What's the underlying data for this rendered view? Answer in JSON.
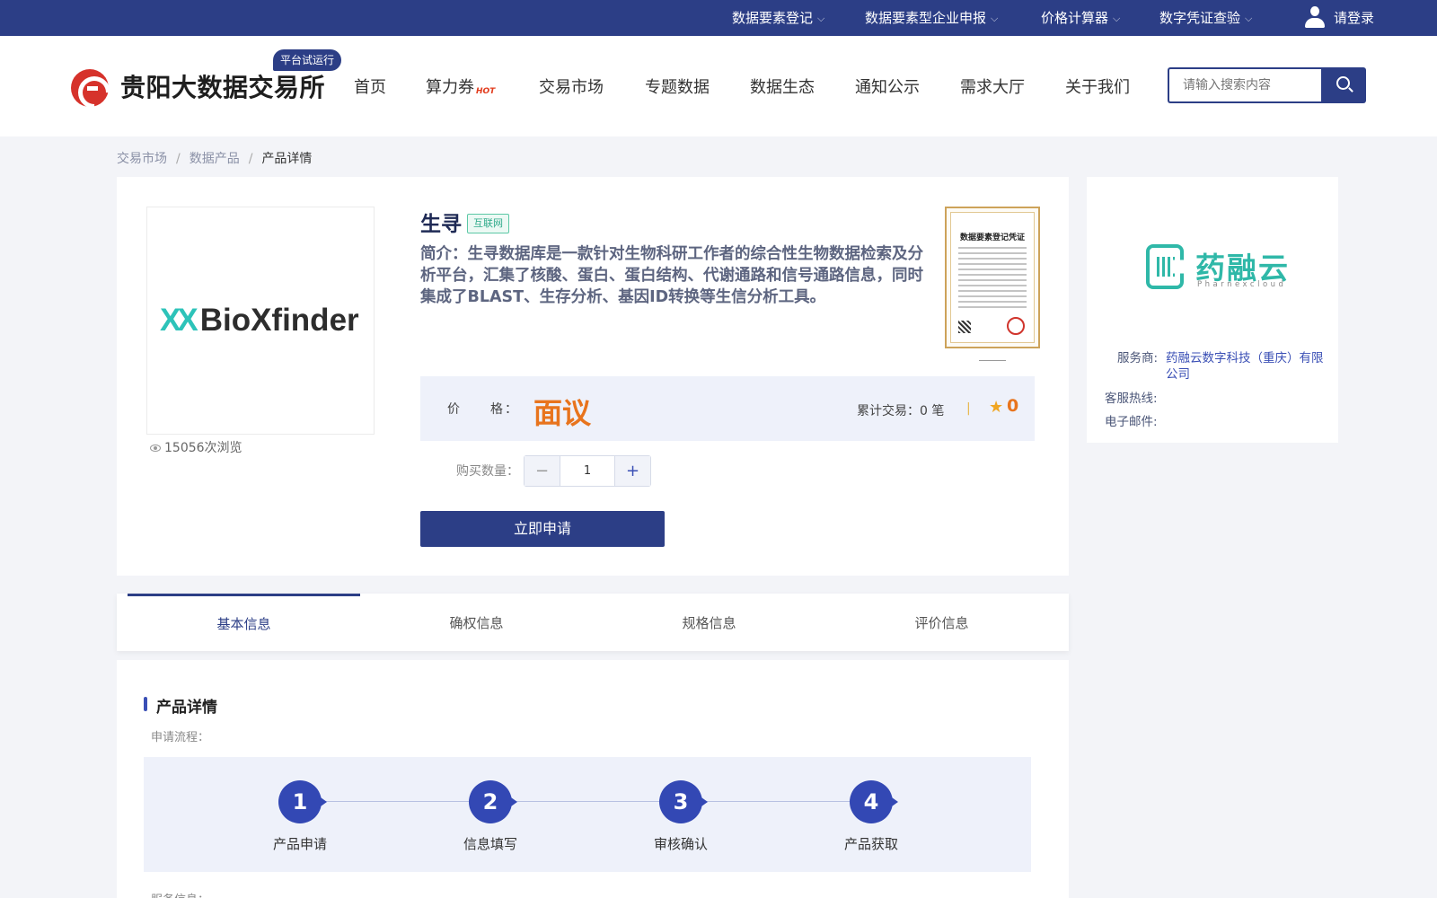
{
  "topbar": {
    "items": [
      {
        "label": "数据要素登记"
      },
      {
        "label": "数据要素型企业申报"
      },
      {
        "label": "价格计算器"
      },
      {
        "label": "数字凭证查验"
      }
    ],
    "login_label": "请登录"
  },
  "header": {
    "logo_text": "贵阳大数据交易所",
    "trial_badge": "平台试运行",
    "nav": [
      {
        "label": "首页"
      },
      {
        "label": "算力券",
        "badge": "HOT"
      },
      {
        "label": "交易市场"
      },
      {
        "label": "专题数据"
      },
      {
        "label": "数据生态"
      },
      {
        "label": "通知公示"
      },
      {
        "label": "需求大厅"
      },
      {
        "label": "关于我们"
      }
    ],
    "search_placeholder": "请输入搜索内容"
  },
  "breadcrumb": {
    "items": [
      "交易市场",
      "数据产品"
    ],
    "current": "产品详情",
    "separator": "/"
  },
  "product": {
    "logo_text": "BioXfinder",
    "logo_mark": "XX",
    "views": "15056次浏览",
    "name": "生寻",
    "tag": "互联网",
    "intro": "简介：生寻数据库是一款针对生物科研工作者的综合性生物数据检索及分析平台，汇集了核酸、蛋白、蛋白结构、代谢通路和信号通路信息，同时集成了BLAST、生存分析、基因ID转换等生信分析工具。",
    "certificate_title": "数据要素登记凭证",
    "price_label": "价　　格：",
    "price": "面议",
    "trades": "累计交易：0 笔",
    "divider": "|",
    "rating": "0",
    "qty_label": "购买数量：",
    "qty_value": "1",
    "qty_minus": "−",
    "qty_plus": "+",
    "apply_label": "立即申请"
  },
  "provider": {
    "logo_cn": "药融云",
    "logo_en": "Pharnexcloud",
    "service_label": "服务商:",
    "service_value": "药融云数字科技（重庆）有限",
    "service_value_2": "公司",
    "hotline_label": "客服热线:",
    "email_label": "电子邮件:"
  },
  "tabs": [
    {
      "label": "基本信息",
      "active": true
    },
    {
      "label": "确权信息"
    },
    {
      "label": "规格信息"
    },
    {
      "label": "评价信息"
    }
  ],
  "details": {
    "section_title": "产品详情",
    "flow_label": "申请流程：",
    "steps": [
      {
        "num": "1",
        "label": "产品申请"
      },
      {
        "num": "2",
        "label": "信息填写"
      },
      {
        "num": "3",
        "label": "审核确认"
      },
      {
        "num": "4",
        "label": "产品获取"
      }
    ],
    "next_label": "服务信息："
  },
  "colors": {
    "brand_navy": "#2c3e86",
    "accent_orange": "#e8741d",
    "logo_red": "#d6322b",
    "teal": "#2fb8a8"
  }
}
